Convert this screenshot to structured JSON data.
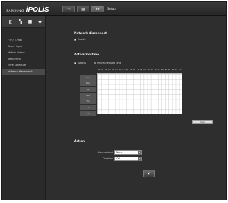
{
  "header": {
    "brand": "SAMSUNG",
    "product": "iPOLiS",
    "nav_buttons": [
      {
        "icon": "monitor-icon",
        "glyph": "▭"
      },
      {
        "icon": "playback-icon",
        "glyph": "▦"
      },
      {
        "icon": "setup-gear-icon",
        "glyph": "✿"
      }
    ],
    "setup_label": "Setup"
  },
  "sidebar": {
    "icons": [
      {
        "name": "video-audio-icon",
        "glyph": "◧"
      },
      {
        "name": "network-icon",
        "glyph": "▚"
      },
      {
        "name": "event-icon",
        "glyph": "■"
      },
      {
        "name": "system-icon",
        "glyph": "◆"
      }
    ],
    "items": [
      {
        "label": "FTP / E-mail"
      },
      {
        "label": "Alarm input"
      },
      {
        "label": "Motion detect"
      },
      {
        "label": "Tampering"
      },
      {
        "label": "Time schedule"
      },
      {
        "label": "Network disconnect",
        "active": true
      }
    ]
  },
  "main": {
    "section_title": "Network disconnect",
    "enable_label": "Enable",
    "activation_title": "Activation time",
    "activation_options": [
      {
        "label": "Always",
        "selected": true
      },
      {
        "label": "Only scheduled time",
        "selected": false
      }
    ],
    "hours": [
      "00",
      "01",
      "02",
      "03",
      "04",
      "05",
      "06",
      "07",
      "08",
      "09",
      "10",
      "11",
      "12",
      "13",
      "14",
      "15",
      "16",
      "17",
      "18",
      "19",
      "20",
      "21",
      "22",
      "23"
    ],
    "days": [
      "Sun",
      "Mon",
      "Tue",
      "Wed",
      "Thu",
      "Fri",
      "Sat"
    ],
    "clear_label": "Clear",
    "action_title": "Action",
    "alarm_output_label": "Alarm output",
    "alarm_output_value": "None",
    "duration_label": "Duration",
    "duration_value": "Off",
    "apply_glyph": "✔"
  }
}
